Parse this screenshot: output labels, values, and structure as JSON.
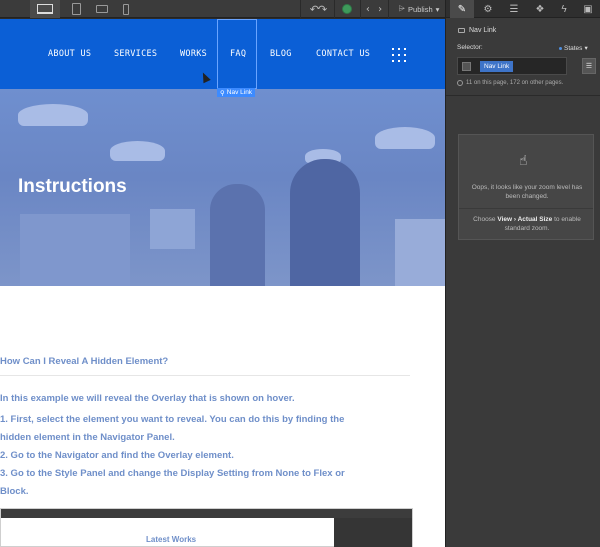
{
  "toolbar": {
    "devices": [
      "desktop",
      "tablet",
      "mobile-landscape",
      "mobile-portrait"
    ],
    "undo_redo": "↶↷",
    "code_icon": "‹ ›",
    "publish_label": "Publish",
    "publish_arrow": "▾"
  },
  "nav": {
    "items": [
      "ABOUT US",
      "SERVICES",
      "WORKS",
      "FAQ",
      "BLOG",
      "CONTACT US"
    ],
    "selected_tag": "Nav Link",
    "color": "#0b5fd6"
  },
  "hero": {
    "title": "Instructions"
  },
  "content": {
    "question": "How Can I Reveal A Hidden Element?",
    "lead": "In this example we will reveal the Overlay that is shown on hover.",
    "steps": [
      "1. First, select the element you want to reveal. You can do this by finding the",
      "hidden element in the Navigator Panel.",
      "2. Go to the Navigator and find the Overlay element.",
      "3. Go to the Style Panel and change the Display Setting from None to Flex or",
      "Block."
    ],
    "embed_title": "Latest Works"
  },
  "panel": {
    "element_name": "Nav Link",
    "selector_label": "Selector:",
    "states_label": "States",
    "selector_chip": "Nav Link",
    "onpage_text": "11 on this page, 172 on other pages.",
    "zoom_message": "Oops, it looks like your zoom level has been changed.",
    "zoom_hint_prefix": "Choose ",
    "zoom_hint_path": "View › Actual Size",
    "zoom_hint_suffix": " to enable standard zoom."
  }
}
